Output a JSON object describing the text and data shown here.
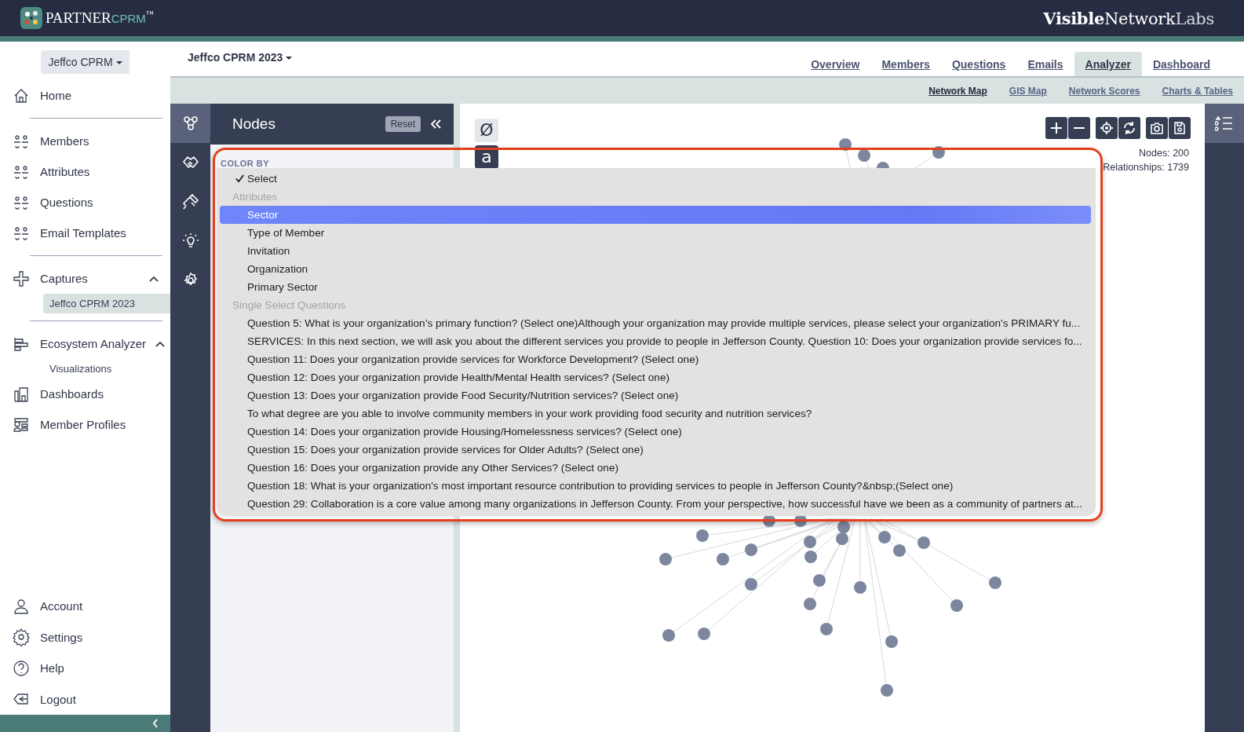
{
  "header": {
    "logo": {
      "name": "PARTNER",
      "product": "CPRM",
      "mark": "™"
    },
    "brand": [
      "Visible",
      "Network",
      "Labs"
    ]
  },
  "sidebar": {
    "account_button": "Jeffco CPRM",
    "groups": [
      [
        {
          "label": "Home"
        }
      ],
      [
        {
          "label": "Members"
        },
        {
          "label": "Attributes"
        },
        {
          "label": "Questions"
        },
        {
          "label": "Email Templates"
        }
      ],
      [
        {
          "label": "Captures",
          "expanded": true,
          "children": [
            {
              "label": "Jeffco CPRM 2023",
              "selected": true
            }
          ]
        }
      ],
      [
        {
          "label": "Ecosystem Analyzer",
          "expanded": true,
          "children": [
            {
              "label": "Visualizations",
              "selected": false
            }
          ]
        },
        {
          "label": "Dashboards"
        },
        {
          "label": "Member Profiles"
        }
      ]
    ],
    "bottom_items": [
      "Account",
      "Settings",
      "Help",
      "Logout"
    ]
  },
  "project": "Jeffco CPRM 2023",
  "tabs": [
    {
      "label": "Overview",
      "selected": false
    },
    {
      "label": "Members",
      "selected": false
    },
    {
      "label": "Questions",
      "selected": false
    },
    {
      "label": "Emails",
      "selected": false
    },
    {
      "label": "Analyzer",
      "selected": true
    },
    {
      "label": "Dashboard",
      "selected": false
    }
  ],
  "subtabs": [
    {
      "label": "Network Map",
      "selected": true
    },
    {
      "label": "GIS Map",
      "selected": false
    },
    {
      "label": "Network Scores",
      "selected": false
    },
    {
      "label": "Charts & Tables",
      "selected": false
    }
  ],
  "tool_rail": [
    {
      "selected": true
    },
    {
      "selected": false
    },
    {
      "selected": false
    },
    {
      "selected": false
    },
    {
      "selected": false
    }
  ],
  "panel": {
    "title": "Nodes",
    "reset": "Reset",
    "color_by_label": "COLOR BY"
  },
  "map": {
    "label_buttons": [
      {
        "label": "Ø",
        "selected": false
      },
      {
        "label": "a",
        "selected": true
      }
    ],
    "nodes": "Nodes: 200",
    "relationships": "Relationships: 1739"
  },
  "dropdown": [
    {
      "kind": "option",
      "text": "Select",
      "checked": true,
      "selected": false
    },
    {
      "kind": "header",
      "text": "Attributes"
    },
    {
      "kind": "option",
      "text": "Sector",
      "checked": false,
      "selected": true
    },
    {
      "kind": "option",
      "text": "Type of Member",
      "checked": false,
      "selected": false
    },
    {
      "kind": "option",
      "text": "Invitation",
      "checked": false,
      "selected": false
    },
    {
      "kind": "option",
      "text": "Organization",
      "checked": false,
      "selected": false
    },
    {
      "kind": "option",
      "text": "Primary Sector",
      "checked": false,
      "selected": false
    },
    {
      "kind": "header",
      "text": "Single Select Questions"
    },
    {
      "kind": "option",
      "text": "Question 5: What is your organization’s primary function? (Select one)Although your organization may provide multiple services, please select your organization's PRIMARY fu...",
      "checked": false,
      "selected": false
    },
    {
      "kind": "option",
      "text": "SERVICES: In this next section, we will ask you about the different services you provide to people in Jefferson County. Question 10: Does your organization provide services fo...",
      "checked": false,
      "selected": false
    },
    {
      "kind": "option",
      "text": "Question 11: Does your organization provide services for Workforce Development? (Select one)",
      "checked": false,
      "selected": false
    },
    {
      "kind": "option",
      "text": "Question 12: Does your organization provide Health/Mental Health services? (Select one)",
      "checked": false,
      "selected": false
    },
    {
      "kind": "option",
      "text": "Question 13: Does your organization provide Food Security/Nutrition services? (Select one)",
      "checked": false,
      "selected": false
    },
    {
      "kind": "option",
      "text": "To what degree are you able to involve community members in your work providing food security and nutrition services?",
      "checked": false,
      "selected": false
    },
    {
      "kind": "option",
      "text": "Question 14: Does your organization provide Housing/Homelessness services? (Select one)",
      "checked": false,
      "selected": false
    },
    {
      "kind": "option",
      "text": "Question 15: Does your organization provide services for Older Adults? (Select one)",
      "checked": false,
      "selected": false
    },
    {
      "kind": "option",
      "text": "Question 16: Does your organization provide any Other Services? (Select one)",
      "checked": false,
      "selected": false
    },
    {
      "kind": "option",
      "text": "Question 18: What is your organization's most important resource contribution to providing services to people in Jefferson County?&nbsp;(Select one)",
      "checked": false,
      "selected": false
    },
    {
      "kind": "option",
      "text": "Question 29: Collaboration is a core value among many organizations in Jefferson County. From your perspective, how successful have we been as a community of partners at...",
      "checked": false,
      "selected": false
    }
  ]
}
